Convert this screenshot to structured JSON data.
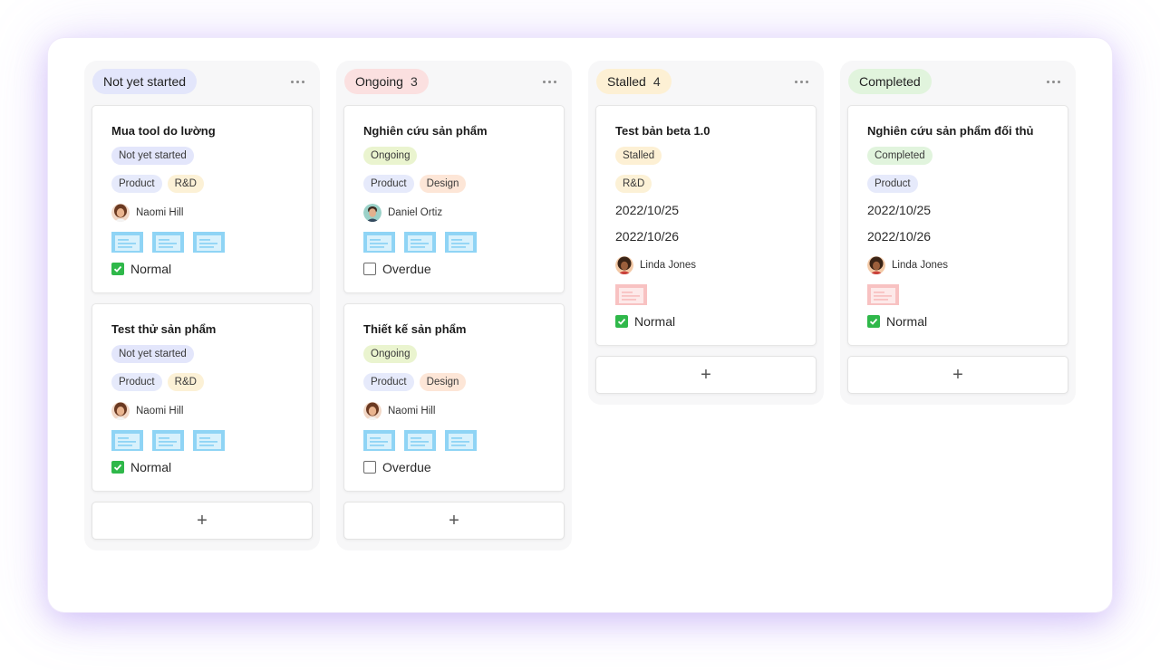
{
  "colors": {
    "not_started_pill": "#e3e6fb",
    "ongoing_pill": "#fbe0e0",
    "stalled_pill": "#fdf0d4",
    "completed_pill": "#e1f4dd",
    "product_tag": "#e6eafb",
    "rnd_tag": "#fcf1d6",
    "design_tag": "#fde6d7",
    "attachment_blue": "#8fd4f5",
    "attachment_pink": "#f8c2c2",
    "check_green": "#2fb84a"
  },
  "columns": [
    {
      "status": "Not yet started",
      "count": "",
      "cards": [
        {
          "title": "Mua tool do lường",
          "status": "Not yet started",
          "tags": [
            "Product",
            "R&D"
          ],
          "assignee": "Naomi Hill",
          "attachments": [
            "doc-icon",
            "doc-icon",
            "doc-icon"
          ],
          "priority": "Normal",
          "checked": true
        },
        {
          "title": "Test thử sản phẩm",
          "status": "Not yet started",
          "tags": [
            "Product",
            "R&D"
          ],
          "assignee": "Naomi Hill",
          "attachments": [
            "doc-icon",
            "doc-icon",
            "doc-icon"
          ],
          "priority": "Normal",
          "checked": true
        }
      ],
      "add_label": "+"
    },
    {
      "status": "Ongoing",
      "count": "3",
      "cards": [
        {
          "title": "Nghiên cứu sản phẩm",
          "status": "Ongoing",
          "tags": [
            "Product",
            "Design"
          ],
          "assignee": "Daniel Ortiz",
          "attachments": [
            "doc-icon",
            "doc-icon",
            "doc-icon"
          ],
          "priority": "Overdue",
          "checked": false
        },
        {
          "title": "Thiết kế sản phẩm",
          "status": "Ongoing",
          "tags": [
            "Product",
            "Design"
          ],
          "assignee": "Naomi Hill",
          "attachments": [
            "doc-icon",
            "doc-icon",
            "doc-icon"
          ],
          "priority": "Overdue",
          "checked": false
        }
      ],
      "add_label": "+"
    },
    {
      "status": "Stalled",
      "count": "4",
      "cards": [
        {
          "title": "Test bản beta 1.0",
          "status": "Stalled",
          "tags": [
            "R&D"
          ],
          "dates": [
            "2022/10/25",
            "2022/10/26"
          ],
          "assignee": "Linda Jones",
          "attachments": [
            "doc-icon"
          ],
          "priority": "Normal",
          "checked": true
        }
      ],
      "add_label": "+"
    },
    {
      "status": "Completed",
      "count": "",
      "cards": [
        {
          "title": "Nghiên cứu sản phẩm đối thủ",
          "status": "Completed",
          "tags": [
            "Product"
          ],
          "dates": [
            "2022/10/25",
            "2022/10/26"
          ],
          "assignee": "Linda Jones",
          "attachments": [
            "doc-icon"
          ],
          "priority": "Normal",
          "checked": true
        }
      ],
      "add_label": "+"
    }
  ]
}
